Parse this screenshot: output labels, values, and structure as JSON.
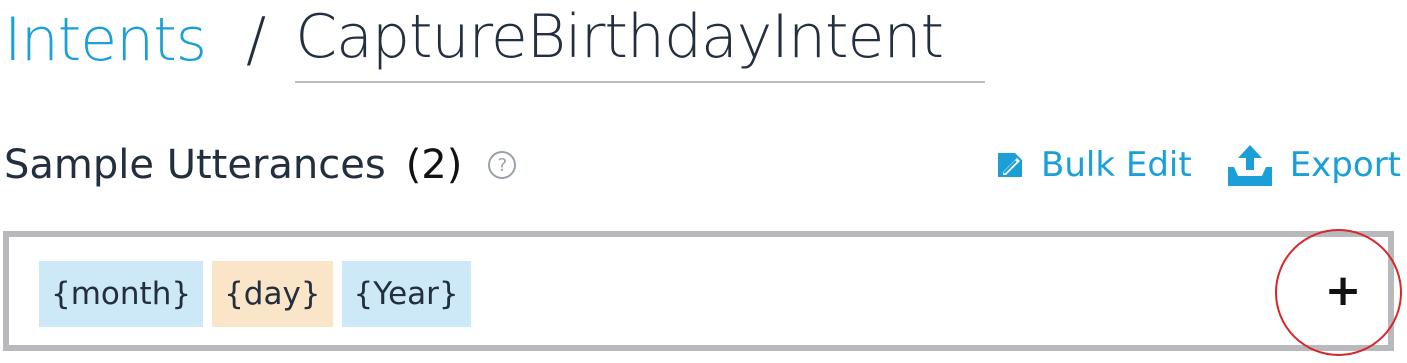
{
  "breadcrumb": {
    "parent": "Intents",
    "separator": "/",
    "current": "CaptureBirthdayIntent"
  },
  "section": {
    "title": "Sample Utterances",
    "count": "(2)",
    "help_icon": "question-circle-icon"
  },
  "actions": {
    "bulk_edit_label": "Bulk Edit",
    "bulk_edit_icon": "bulk-edit-icon",
    "export_label": "Export",
    "export_icon": "upload-icon"
  },
  "utterance": {
    "slots": [
      {
        "label": "{month}",
        "color": "#cde8f7"
      },
      {
        "label": "{day}",
        "color": "#fbe5c8"
      },
      {
        "label": "{Year}",
        "color": "#cde8f7"
      }
    ],
    "add_label": "+"
  },
  "colors": {
    "accent": "#1aa0d6",
    "text": "#232f3e",
    "highlight": "#d9262c"
  }
}
